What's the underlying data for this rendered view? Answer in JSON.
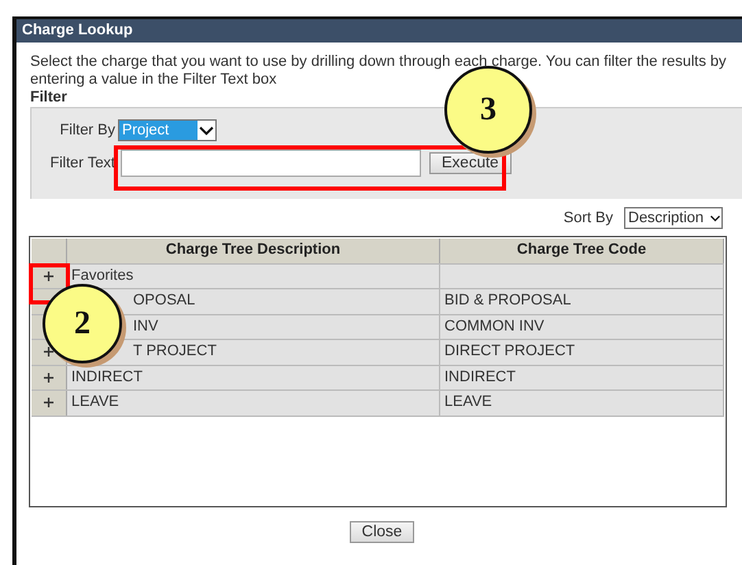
{
  "window": {
    "title": "Charge Lookup"
  },
  "instructions": "Select the charge that you want to use by drilling down through each charge. You can filter the results by entering a value in the Filter Text box",
  "filter": {
    "legend": "Filter",
    "filter_by_label": "Filter By",
    "filter_by_value": "Project",
    "filter_text_label": "Filter Text",
    "execute_button": "Execute"
  },
  "sort": {
    "label": "Sort By",
    "value": "Description"
  },
  "table": {
    "columns": [
      "Charge Tree Description",
      "Charge Tree Code"
    ],
    "rows": [
      {
        "expanded": false,
        "description": "Favorites",
        "code": "",
        "covered": false
      },
      {
        "description": "OPOSAL",
        "code": "BID & PROPOSAL",
        "covered": true
      },
      {
        "description": "INV",
        "code": "COMMON INV",
        "covered": true
      },
      {
        "expanded": false,
        "description": "T PROJECT",
        "code": "DIRECT PROJECT",
        "covered": true
      },
      {
        "expanded": false,
        "description": "INDIRECT",
        "code": "INDIRECT",
        "covered": false
      },
      {
        "expanded": false,
        "description": "LEAVE",
        "code": "LEAVE",
        "covered": false
      }
    ]
  },
  "close_button": "Close",
  "callouts": [
    {
      "number": "3"
    },
    {
      "number": "2"
    }
  ]
}
